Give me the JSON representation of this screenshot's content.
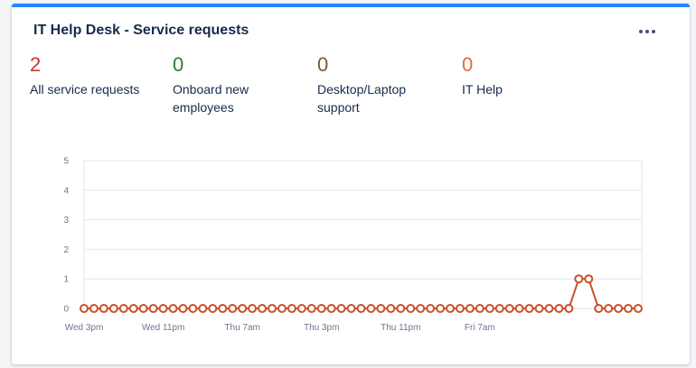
{
  "widget": {
    "title": "IT Help Desk - Service requests",
    "more_icon": "more-horizontal-icon",
    "accent_color": "#2684ff"
  },
  "metrics": [
    {
      "value": "2",
      "label": "All service requests",
      "color": "#c9372c"
    },
    {
      "value": "0",
      "label": "Onboard new employees",
      "color": "#2e7d32"
    },
    {
      "value": "0",
      "label": "Desktop/Laptop support",
      "color": "#7a5c2e"
    },
    {
      "value": "0",
      "label": "IT Help",
      "color": "#e06c3a"
    }
  ],
  "chart_data": {
    "type": "line",
    "series": [
      {
        "color": "#c9502c",
        "values": [
          0,
          0,
          0,
          0,
          0,
          0,
          0,
          0,
          0,
          0,
          0,
          0,
          0,
          0,
          0,
          0,
          0,
          0,
          0,
          0,
          0,
          0,
          0,
          0,
          0,
          0,
          0,
          0,
          0,
          0,
          0,
          0,
          0,
          0,
          0,
          0,
          0,
          0,
          0,
          0,
          0,
          0,
          0,
          0,
          0,
          0,
          0,
          0,
          0,
          0,
          1,
          1,
          0,
          0,
          0,
          0,
          0
        ]
      }
    ],
    "x_ticks": [
      {
        "index": 0,
        "label": "Wed 3pm"
      },
      {
        "index": 8,
        "label": "Wed 11pm"
      },
      {
        "index": 16,
        "label": "Thu 7am"
      },
      {
        "index": 24,
        "label": "Thu 3pm"
      },
      {
        "index": 32,
        "label": "Thu 11pm"
      },
      {
        "index": 40,
        "label": "Fri 7am"
      }
    ],
    "y_ticks": [
      "0",
      "1",
      "2",
      "3",
      "4",
      "5"
    ],
    "ylim": [
      0,
      5
    ],
    "grid": true
  }
}
